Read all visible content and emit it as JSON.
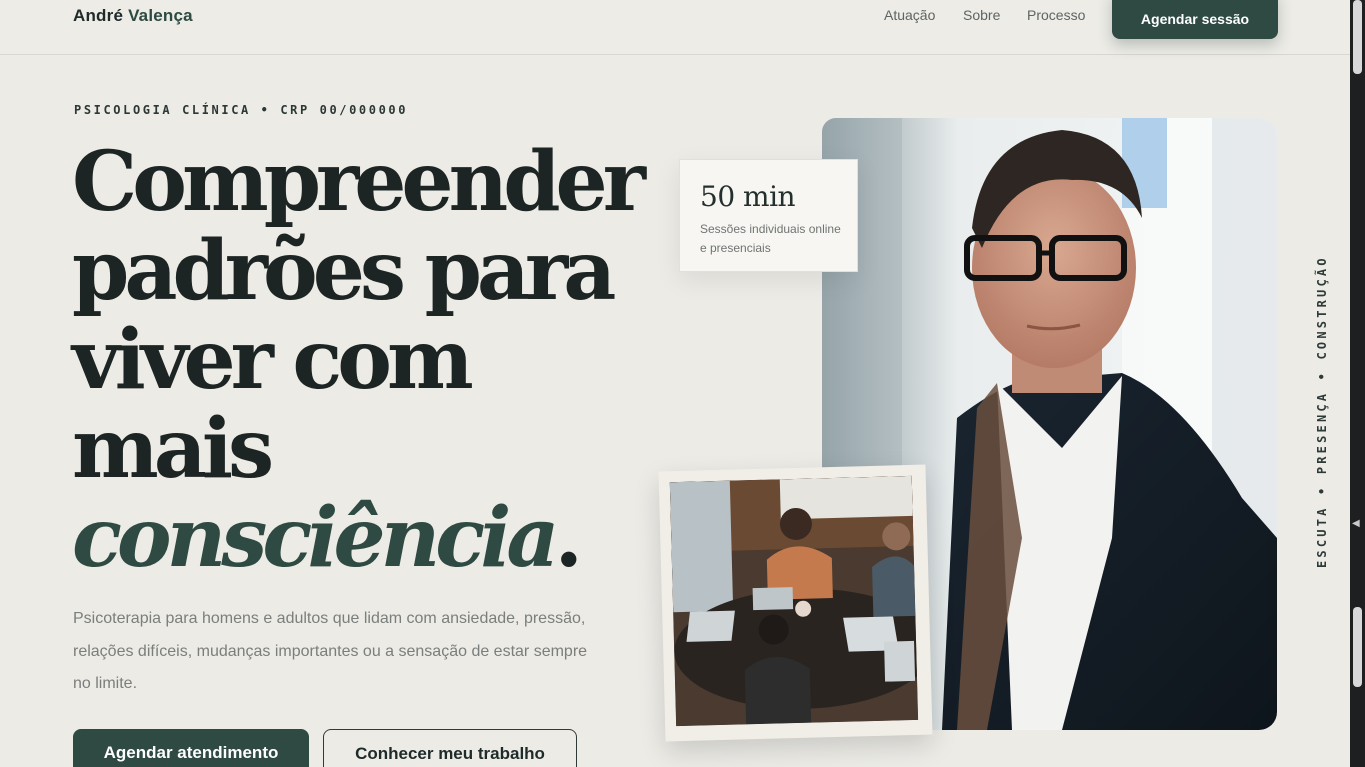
{
  "header": {
    "brand_first": "André",
    "brand_last": "Valença",
    "nav": [
      "Atuação",
      "Sobre",
      "Processo"
    ],
    "cta": "Agendar sessão"
  },
  "hero": {
    "eyebrow": "PSICOLOGIA CLÍNICA • CRP 00/000000",
    "headline_lines": [
      "Compreender",
      "padrões para",
      "viver com",
      "mais"
    ],
    "headline_accent": "consciência",
    "headline_dot": ".",
    "lead": "Psicoterapia para homens e adultos que lidam com ansiedade, pressão, relações difíceis, mudanças importantes ou a sensação de estar sempre no limite.",
    "btn_primary": "Agendar atendimento",
    "btn_secondary": "Conhecer meu trabalho"
  },
  "stat": {
    "value": "50 min",
    "description": "Sessões individuais online e presenciais"
  },
  "side_text": "ESCUTA • PRESENÇA • CONSTRUÇÃO",
  "colors": {
    "accent": "#2f4a43",
    "background": "#ecebe6",
    "text": "#1c2424"
  }
}
